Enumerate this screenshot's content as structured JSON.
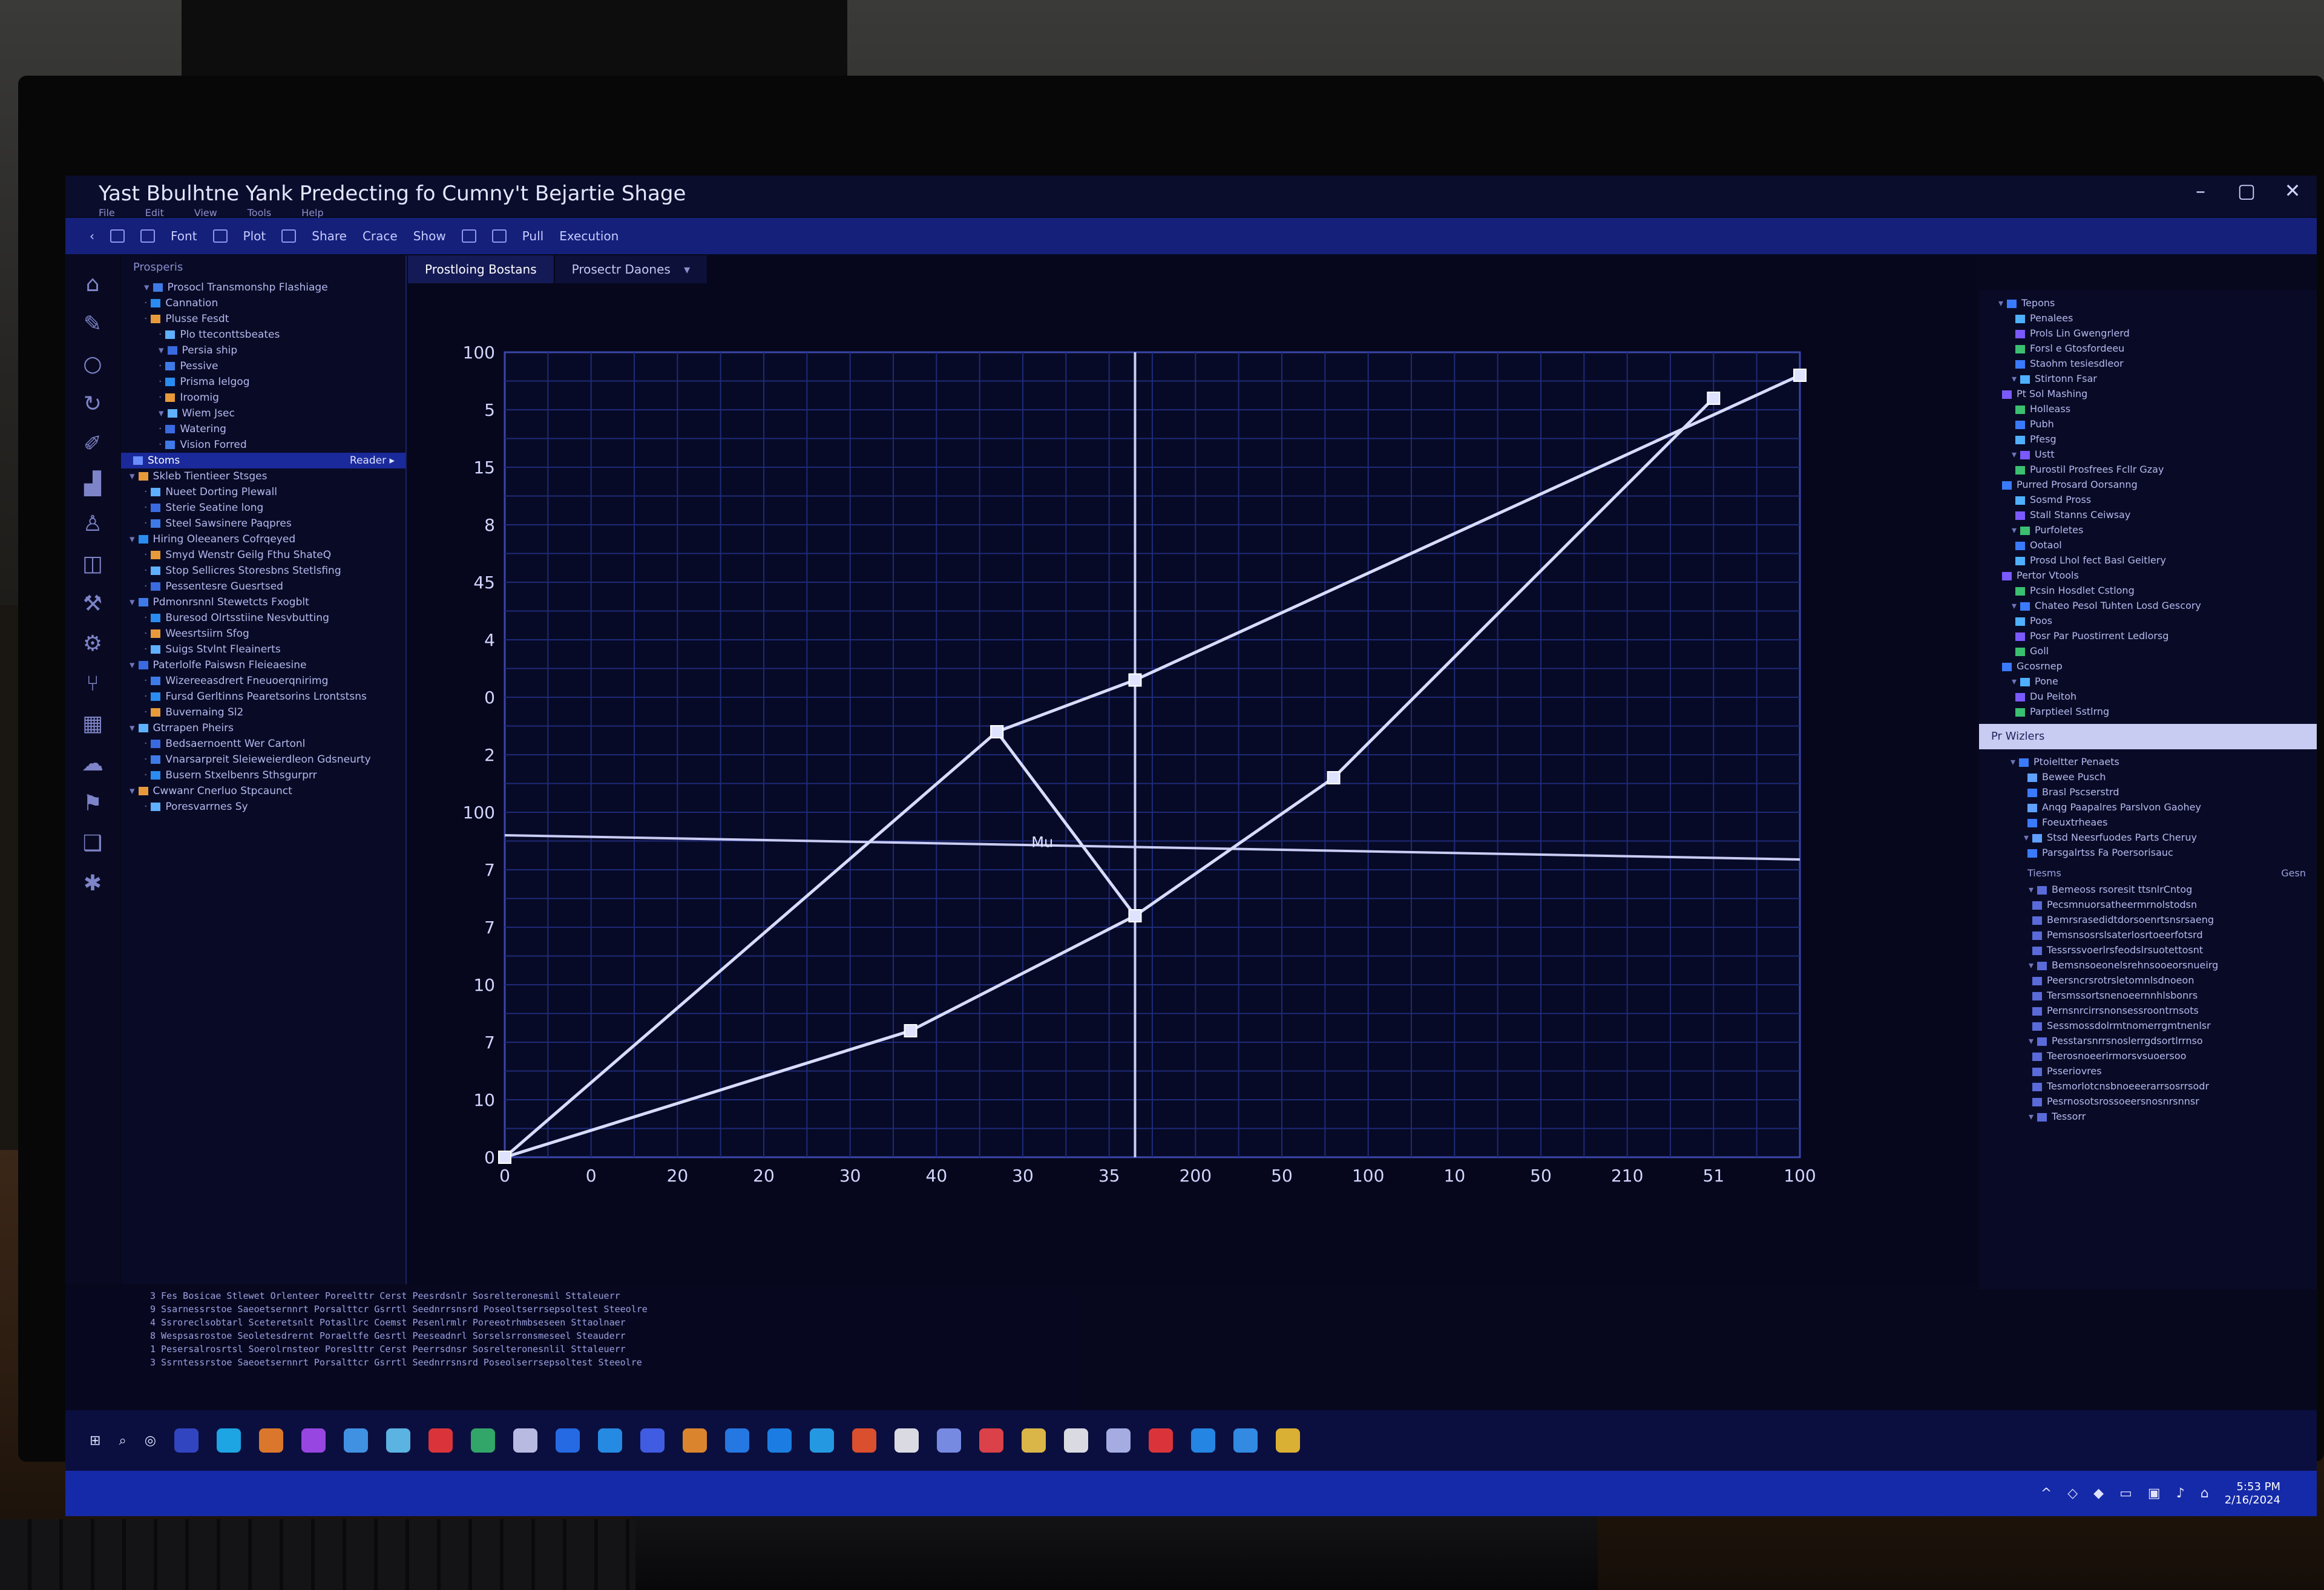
{
  "window": {
    "title": "Yast Bbulhtne Yank Predecting fo Cumny't Bejartie Shage",
    "controls": [
      "–",
      "▢",
      "✕"
    ],
    "menu": [
      "File",
      "Edit",
      "View",
      "Tools",
      "Help"
    ]
  },
  "toolbar": {
    "items": [
      "Font",
      "Plot",
      "Share",
      "Crace",
      "Show",
      "Pull",
      "Execution"
    ]
  },
  "rail_icons": [
    "home-icon",
    "pencil-icon",
    "circle-icon",
    "refresh-icon",
    "brush-icon",
    "chart-icon",
    "person-icon",
    "layers-icon",
    "wrench-icon",
    "settings-icon",
    "branch-icon",
    "grid-icon",
    "cloud-icon",
    "flag-icon",
    "book-icon",
    "puzzle-icon"
  ],
  "explorer": {
    "header": "Prosperis",
    "selected_label": "Stoms",
    "selected_badge": "Reader ▸",
    "items": [
      "Prosocl Transmonshp Flashiage",
      "Cannation",
      "Plusse Fesdt",
      "Plo tteconttsbeates",
      "Persia ship",
      "Pessive",
      "Prisma Ielgog",
      "Iroomig",
      "Wiem Jsec",
      "Watering",
      "Vision Forred",
      "Stoms",
      "Skleb Tientieer Stsges",
      "Nueet Dorting Plewall",
      "Sterie Seatine long",
      "Steel Sawsinere Paqpres",
      "Hiring Oleeaners Cofrqeyed",
      "Smyd Wenstr Geilg Fthu ShateQ",
      "Stop Sellicres Storesbns Stetlsfing",
      "Pessentesre Guesrtsed",
      "Pdmonrsnnl Stewetcts Fxogblt",
      "Buresod Olrtsstiine Nesvbutting",
      "Weesrtsiirn Sfog",
      "Suigs Stvlnt Fleainerts",
      "Paterlolfe Paiswsn Fleieaesine",
      "Wizereeasdrert Fneuoerqnirimg",
      "Fursd Gerltinns Pearetsorins Lrontstsns",
      "Buvernaing Sl2",
      "Gtrrapen Pheirs",
      "Bedsaernoentt Wer Cartonl",
      "Vnarsarpreit Sleieweierdleon Gdsneurty",
      "Busern Stxelbenrs Sthsgurprr",
      "Cwwanr Cnerluo Stpcaunct",
      "Poresvarrnes Sy"
    ]
  },
  "tabs": [
    {
      "label": "Prostloing Bostans",
      "active": true
    },
    {
      "label": "Prosectr Daones",
      "active": false
    }
  ],
  "chart_data": {
    "type": "line",
    "title": "",
    "xlabel": "",
    "ylabel": "",
    "x_ticks": [
      "0",
      "0",
      "20",
      "20",
      "30",
      "40",
      "30",
      "35",
      "200",
      "50",
      "100",
      "10",
      "50",
      "210",
      "51",
      "100"
    ],
    "y_ticks": [
      "100",
      "5",
      "15",
      "8",
      "45",
      "4",
      "0",
      "2",
      "100",
      "7",
      "7",
      "10",
      "7",
      "10",
      "0"
    ],
    "x_range": [
      0,
      15
    ],
    "y_range": [
      0,
      14
    ],
    "reference_lines": {
      "vertical_x": 7.3,
      "horizontal_y": 5.6
    },
    "annotation": {
      "text": "Mu",
      "x": 6.1,
      "y": 5.5
    },
    "series": [
      {
        "points": [
          [
            0,
            0
          ],
          [
            5.7,
            7.4
          ],
          [
            7.3,
            8.3
          ],
          [
            15,
            13.6
          ]
        ]
      },
      {
        "points": [
          [
            0,
            0
          ],
          [
            4.7,
            2.2
          ],
          [
            7.3,
            4.2
          ],
          [
            9.6,
            6.6
          ],
          [
            14,
            13.2
          ]
        ]
      },
      {
        "points": [
          [
            5.7,
            7.4
          ],
          [
            7.3,
            4.2
          ]
        ]
      }
    ]
  },
  "properties": {
    "top_items": [
      "Tepons",
      "Penalees",
      "Prols Lin Gwengrlerd",
      "Forsl e Gtosfordeeu",
      "Staohm tesiesdleor",
      "Stirtonn Fsar",
      "Pt Sol Mashing",
      "Holleass",
      "Pubh",
      "Pfesg",
      "Ustt",
      "Purostil Prosfrees Fcllr Gzay",
      "Purred Prosard Oorsanng",
      "Sosmd Pross",
      "Stall Stanns Ceiwsay",
      "Purfoletes",
      "Ootaol",
      "Prosd Lhol fect Basl Geitlery",
      "Pertor Vtools",
      "Pcsin Hosdlet Cstlong",
      "Chateo Pesol Tuhten Losd Gescory",
      "Poos",
      "Posr Par Puostirrent Ledlorsg",
      "Goll",
      "Gcosrnep",
      "Pone",
      "Du Peitoh",
      "Parptieel Sstlrng"
    ],
    "lower_header": "Pr Wizlers",
    "lower_items": [
      "Ptoieltter Penaets",
      "Bewee Pusch",
      "Brasl Pscserstrd",
      "Anqg Paapalres Parslvon Gaohey",
      "Foeuxtrheaes",
      "Stsd Neesrfuodes Parts Cheruy",
      "Parsgalrtss Fa Poersorisauc"
    ],
    "list_header": "Tiesms",
    "list_right": "Gesn",
    "list_items": [
      "Bemeoss rsoresit ttsnlrCntog",
      "Pecsmnuorsatheermrnolstodsn",
      "Bemrsrasedidtdorsoenrtsnsrsaeng",
      "Pemsnsosrslsaterlosrtoeerfotsrd",
      "Tessrssvoerlrsfeodslrsuotettosnt",
      "Bemsnsoeonelsrehnsooeorsnueirg",
      "Peersncrsrotrsletomnlsdnoeon",
      "Tersmssortsnenoeernnhlsbonrs",
      "Pernsnrcirrsnonsessroontrnsots",
      "Sessmossdolrmtnomerrgmtnenlsr",
      "Pesstarsnrrsnoslerrgdsortlrrnso",
      "Teerosnoeerirmorsvsuoersoo",
      "Psseriovres",
      "Tesmorlotcnsbnoeeerarrsosrrsodr",
      "Pesrnosotsrossoeersnosnrsnnsr",
      "Tessorr"
    ]
  },
  "console": {
    "lines": [
      "3 Fes Bosicae Stlewet Orlenteer  Poreelttr Cerst Peesrdsnlr  Sosrelteronesmil Sttaleuerr",
      "9 Ssarnessrstoe Saeoetsernnrt  Porsalttcr Gsrrtl Seednrrsnsrd  Poseoltserrsepsoltest Steeolre",
      "4 Ssroreclsobtarl Sceteretsnlt  Potasllrc Coemst Pesenlrmlr  Poreeotrhmbseseen Sttaolnaer",
      "8 Wespsasrostoe Seoletesdrernt  Poraeltfe Gesrtl Peeseadnrl  Sorselsrronsmeseel Steauderr",
      "1 Pesersalrosrtsl Soerolrnsteor  Poreslttr Cerst Peerrsdnsr  Sosrelteronesnlil Sttaleuerr",
      "3 Ssrntessrstoe Saeoetsernnrt  Porsalttcr Gsrrtl Seednrrsnsrd  Poseolserrsepsoltest Steeolre"
    ]
  },
  "taskbar": {
    "icon_colors": [
      "#3a4fd8",
      "#20c0ff",
      "#ff8a2a",
      "#b050ff",
      "#4aa8ff",
      "#6ad0ff",
      "#ff3a3a",
      "#3ac070",
      "#d8d8ff",
      "#2a7aff",
      "#2aa0ff",
      "#4a6aff",
      "#ff9a2a",
      "#2a8aff",
      "#1e90ff",
      "#2ab0ff",
      "#ff5a2a",
      "#ffffff",
      "#8aa0ff",
      "#ff4a4a",
      "#ffd24a",
      "#ffffff",
      "#c0c8ff",
      "#ff3a3a",
      "#2a9aff",
      "#3aa0ff",
      "#ffcc33"
    ]
  },
  "tray": {
    "icons": [
      "^",
      "◇",
      "◆",
      "▭",
      "▣",
      "♪",
      "⌂"
    ],
    "time": "5:53 PM",
    "date": "2/16/2024"
  },
  "colors": {
    "accent": "#1d2fb8",
    "chart_line": "#d8dcff",
    "grid": "#1f2a78",
    "background": "#06071c"
  }
}
